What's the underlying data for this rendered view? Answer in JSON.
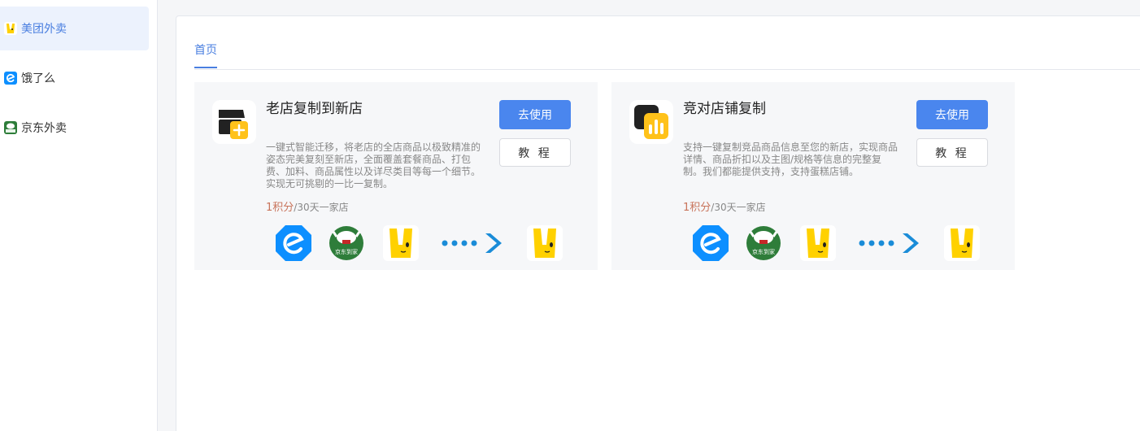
{
  "sidebar": {
    "items": [
      {
        "label": "美团外卖",
        "icon": "meituan-icon",
        "active": true
      },
      {
        "label": "饿了么",
        "icon": "eleme-icon",
        "active": false
      },
      {
        "label": "京东外卖",
        "icon": "jd-icon",
        "active": false
      }
    ]
  },
  "tabs": [
    {
      "label": "首页"
    }
  ],
  "cards": [
    {
      "title": "老店复制到新店",
      "description": "一键式智能迁移，将老店的全店商品以极致精准的姿态完美复刻至新店，全面覆盖套餐商品、打包费、加料、商品属性以及详尽类目等每一个细节。实现无可挑剔的一比一复制。",
      "cost_points": "1积分",
      "cost_period": "/30天一家店",
      "use_button": "去使用",
      "tutorial_button": "教 程",
      "icon": "store-copy-icon",
      "flow_icons": [
        "eleme-logo-icon",
        "jd-daojia-logo-icon",
        "meituan-logo-icon",
        "arrow-right-icon",
        "meituan-logo-icon"
      ],
      "jd_logo_text": "京东到家"
    },
    {
      "title": "竞对店铺复制",
      "description": "支持一键复制竞品商品信息至您的新店，实现商品详情、商品折扣以及主图/规格等信息的完整复制。我们都能提供支持，支持蛋糕店铺。",
      "cost_points": "1积分",
      "cost_period": "/30天一家店",
      "use_button": "去使用",
      "tutorial_button": "教 程",
      "icon": "competitor-chart-icon",
      "flow_icons": [
        "eleme-logo-icon",
        "jd-daojia-logo-icon",
        "meituan-logo-icon",
        "arrow-right-icon",
        "meituan-logo-icon"
      ],
      "jd_logo_text": "京东到家"
    }
  ],
  "colors": {
    "accent": "#4a86ee",
    "active_bg": "#ecf2fd",
    "meituan_yellow": "#ffd100",
    "eleme_blue": "#0d8fff",
    "jd_green": "#2e7d3a",
    "points": "#c8735a"
  }
}
